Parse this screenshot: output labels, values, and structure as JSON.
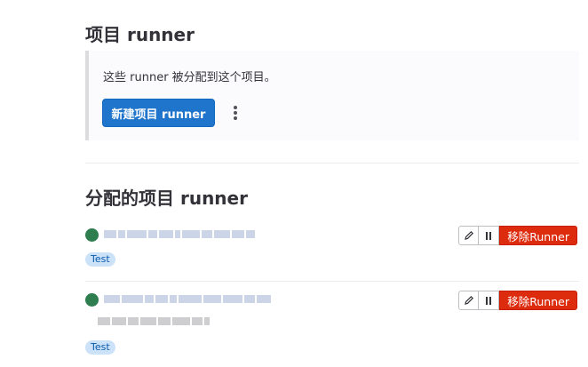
{
  "project_runners": {
    "title": "项目 runner",
    "description": "这些 runner 被分配到这个项目。",
    "new_button_label": "新建项目 runner"
  },
  "assigned_runners": {
    "title": "分配的项目 runner",
    "runners": [
      {
        "status": "online",
        "status_color": "#2f7e50",
        "tag": "Test",
        "remove_label": "移除Runner"
      },
      {
        "status": "online",
        "status_color": "#2f7e50",
        "tag": "Test",
        "remove_label": "移除Runner"
      }
    ]
  },
  "icons": {
    "edit": "pencil-icon",
    "pause": "pause-icon",
    "more": "kebab-menu-icon"
  },
  "colors": {
    "primary": "#1f75cb",
    "danger": "#dd2b0e",
    "tag_bg": "#cbe2f9"
  }
}
